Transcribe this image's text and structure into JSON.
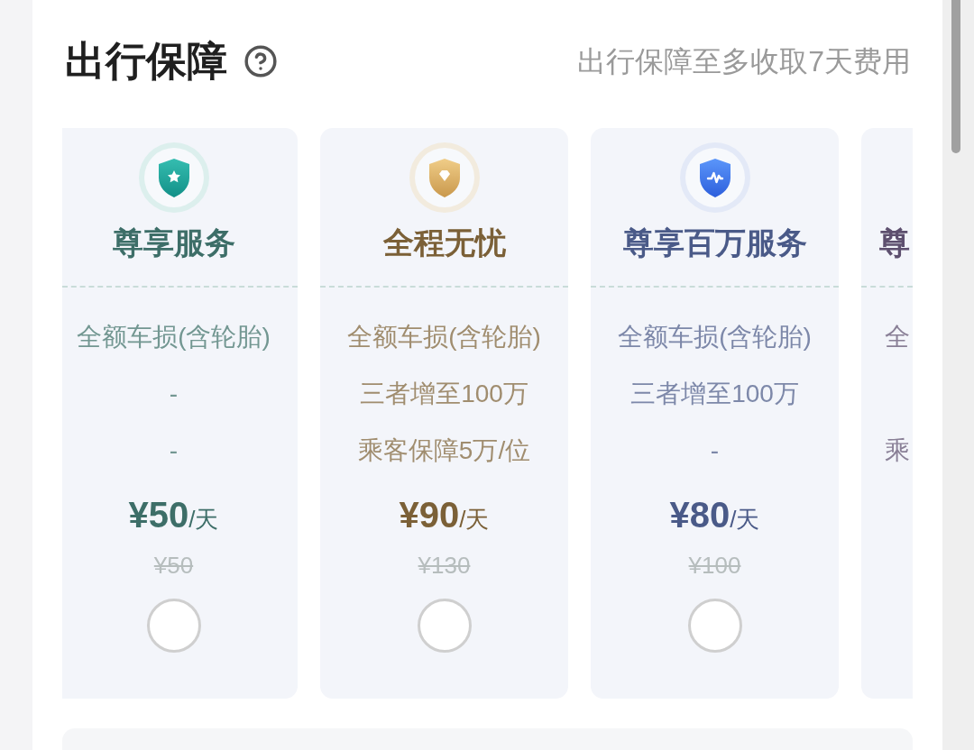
{
  "header": {
    "title": "出行保障",
    "note": "出行保障至多收取7天费用"
  },
  "plans": [
    {
      "kind": "star",
      "color": "#3d6e68",
      "title": "尊享服务",
      "features": [
        "全额车损(含轮胎)",
        "-",
        "-"
      ],
      "price": "¥50",
      "unit": "/天",
      "original_price": "¥50",
      "selected": false
    },
    {
      "kind": "diamond",
      "color": "#7b6037",
      "title": "全程无忧",
      "features": [
        "全额车损(含轮胎)",
        "三者增至100万",
        "乘客保障5万/位"
      ],
      "price": "¥90",
      "unit": "/天",
      "original_price": "¥130",
      "selected": false
    },
    {
      "kind": "pulse",
      "color": "#4a5a88",
      "title": "尊享百万服务",
      "features": [
        "全额车损(含轮胎)",
        "三者增至100万",
        "-"
      ],
      "price": "¥80",
      "unit": "/天",
      "original_price": "¥100",
      "selected": false
    },
    {
      "kind": "partial",
      "color": "#5d4f6e",
      "title": "尊",
      "features": [
        "全",
        "乘"
      ]
    }
  ]
}
